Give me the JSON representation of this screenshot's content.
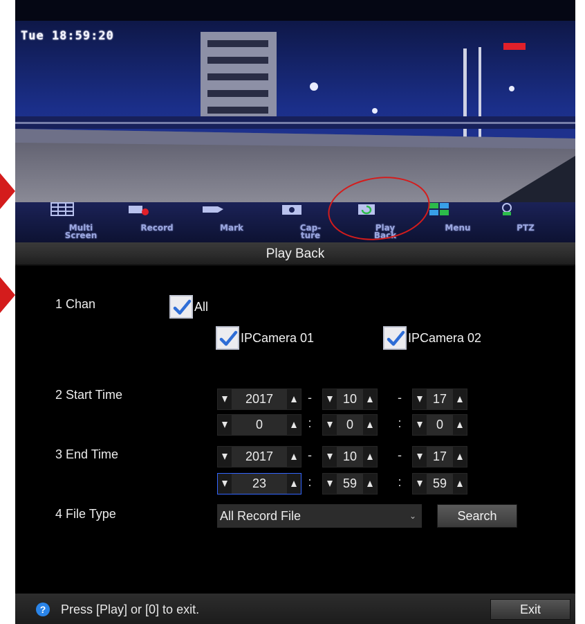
{
  "camera_view": {
    "clock": "Tue 18:59:20",
    "toolbar": [
      {
        "id": "multi",
        "label_lines": [
          "Multi",
          "Screen"
        ],
        "icon": "grid-icon"
      },
      {
        "id": "record",
        "label_lines": [
          "Record",
          ""
        ],
        "icon": "record-icon"
      },
      {
        "id": "mark",
        "label_lines": [
          "Mark",
          ""
        ],
        "icon": "mark-icon"
      },
      {
        "id": "capture",
        "label_lines": [
          "Cap-",
          "ture"
        ],
        "icon": "camera-icon"
      },
      {
        "id": "playback",
        "label_lines": [
          "Play",
          "Back"
        ],
        "icon": "playback-icon"
      },
      {
        "id": "menu",
        "label_lines": [
          "Menu",
          ""
        ],
        "icon": "menu-icon"
      },
      {
        "id": "ptz",
        "label_lines": [
          "PTZ",
          ""
        ],
        "icon": "ptz-icon"
      }
    ]
  },
  "dialog": {
    "title": "Play Back",
    "channel": {
      "label": "1 Chan",
      "all": {
        "label": "All",
        "checked": true
      },
      "cameras": [
        {
          "label": "IPCamera 01",
          "checked": true
        },
        {
          "label": "IPCamera 02",
          "checked": true
        }
      ]
    },
    "start_time": {
      "label": "2 Start Time",
      "date": {
        "year": "2017",
        "month": "10",
        "day": "17"
      },
      "time": {
        "hour": "0",
        "minute": "0",
        "second": "0"
      }
    },
    "end_time": {
      "label": "3 End Time",
      "date": {
        "year": "2017",
        "month": "10",
        "day": "17"
      },
      "time": {
        "hour": "23",
        "minute": "59",
        "second": "59"
      }
    },
    "separators": {
      "date": "-",
      "time": ":"
    },
    "file_type": {
      "label": "4 File Type",
      "selected": "All Record File"
    },
    "search_label": "Search",
    "hint": "Press [Play] or [0] to exit.",
    "exit_label": "Exit"
  },
  "colors": {
    "accent_blue": "#3366ff",
    "annotation_red": "#d41c1c",
    "help_icon_blue": "#2a84e8",
    "checkbox_check": "#2e6dd6"
  }
}
